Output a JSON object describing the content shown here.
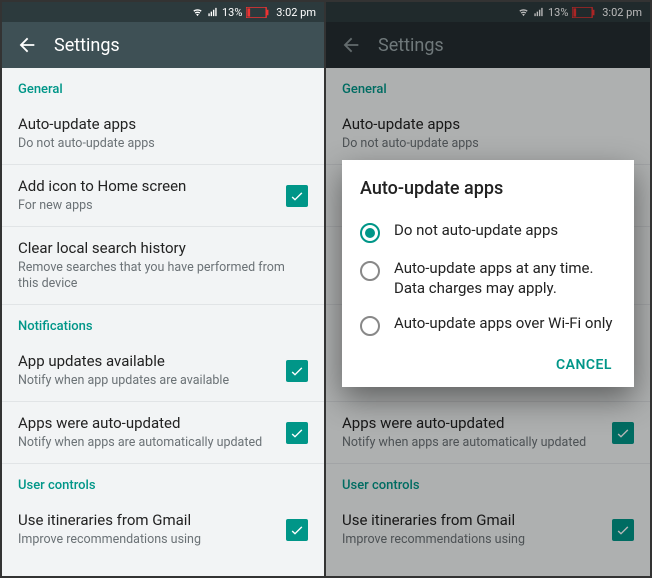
{
  "status": {
    "battery": "13%",
    "time": "3:02 pm"
  },
  "appbar": {
    "title": "Settings"
  },
  "sections": {
    "general": "General",
    "notifications": "Notifications",
    "user_controls": "User controls"
  },
  "rows": {
    "auto_update": {
      "title": "Auto-update apps",
      "sub": "Do not auto-update apps"
    },
    "add_icon": {
      "title": "Add icon to Home screen",
      "sub": "For new apps"
    },
    "clear_search": {
      "title": "Clear local search history",
      "sub": "Remove searches that you have performed from this device"
    },
    "updates_avail": {
      "title": "App updates available",
      "sub": "Notify when app updates are available"
    },
    "auto_updated": {
      "title": "Apps were auto-updated",
      "sub": "Notify when apps are automatically updated"
    },
    "gmail": {
      "title": "Use itineraries from Gmail",
      "sub": "Improve recommendations using"
    }
  },
  "dialog": {
    "title": "Auto-update apps",
    "options": {
      "opt1": "Do not auto-update apps",
      "opt2": "Auto-update apps at any time. Data charges may apply.",
      "opt3": "Auto-update apps over Wi-Fi only"
    },
    "cancel": "CANCEL"
  }
}
